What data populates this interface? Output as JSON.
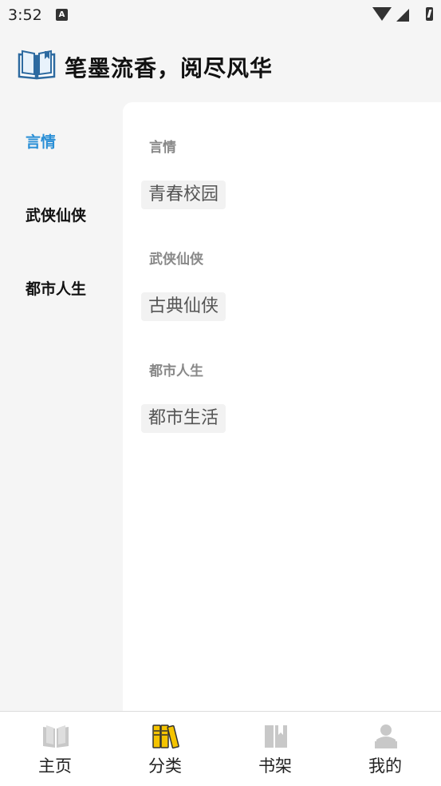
{
  "status_bar": {
    "time": "3:52",
    "notification_icon": "A"
  },
  "header": {
    "title": "笔墨流香，阅尽风华",
    "logo_icon": "open-book-icon"
  },
  "categories": [
    {
      "label": "言情",
      "active": true
    },
    {
      "label": "武侠仙侠",
      "active": false
    },
    {
      "label": "都市人生",
      "active": false
    }
  ],
  "sections": [
    {
      "title": "言情",
      "tags": [
        "青春校园"
      ]
    },
    {
      "title": "武侠仙侠",
      "tags": [
        "古典仙侠"
      ]
    },
    {
      "title": "都市人生",
      "tags": [
        "都市生活"
      ]
    }
  ],
  "bottom_nav": [
    {
      "label": "主页",
      "icon": "book-icon"
    },
    {
      "label": "分类",
      "icon": "category-books-icon",
      "active": true
    },
    {
      "label": "书架",
      "icon": "bookshelf-icon"
    },
    {
      "label": "我的",
      "icon": "profile-icon"
    }
  ],
  "colors": {
    "accent": "#2a8fd6",
    "active_nav_icon": "#f5c400",
    "inactive_nav_icon": "#c8c8c8"
  }
}
